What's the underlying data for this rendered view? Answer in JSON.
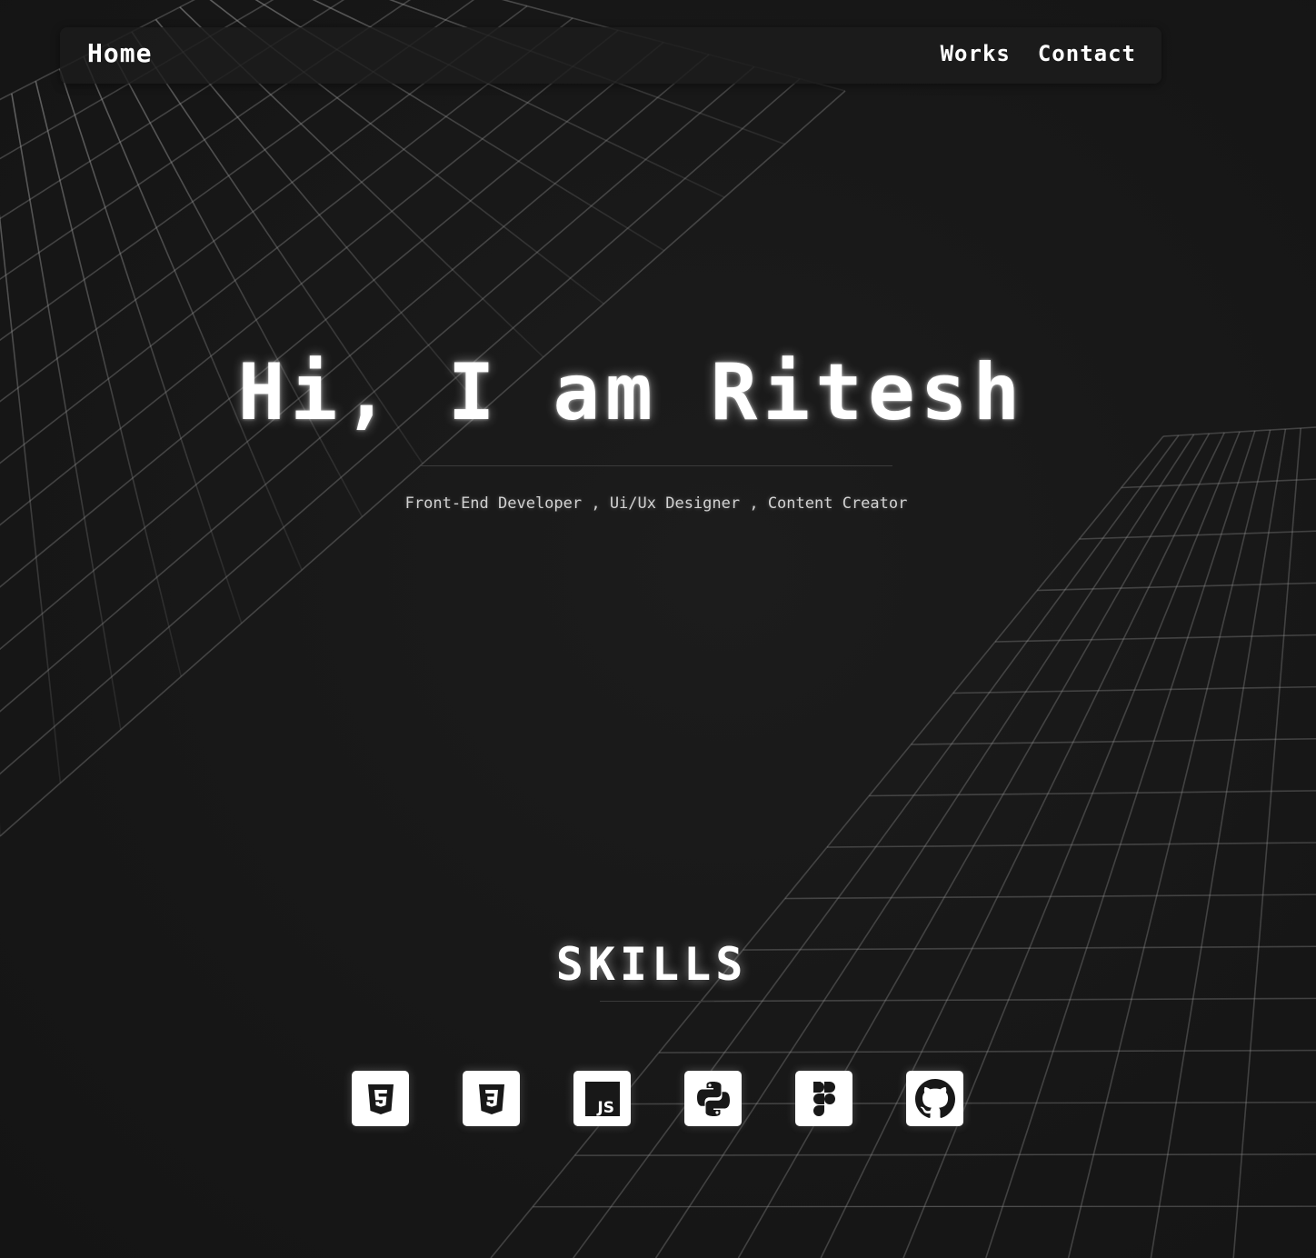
{
  "nav": {
    "home_label": "Home",
    "links": [
      {
        "label": "Works"
      },
      {
        "label": "Contact"
      }
    ]
  },
  "hero": {
    "title": "Hi, I am Ritesh",
    "subtitle": "Front-End Developer , Ui/Ux Designer , Content Creator"
  },
  "skills": {
    "title": "SKILLS",
    "icons": [
      {
        "name": "html5-icon"
      },
      {
        "name": "css3-icon"
      },
      {
        "name": "javascript-icon"
      },
      {
        "name": "python-icon"
      },
      {
        "name": "figma-icon"
      },
      {
        "name": "github-icon"
      }
    ]
  },
  "colors": {
    "background": "#181818",
    "text": "#ffffff",
    "tile": "#ffffff",
    "icon": "#181818",
    "grid_line": "#8a8a8a"
  }
}
